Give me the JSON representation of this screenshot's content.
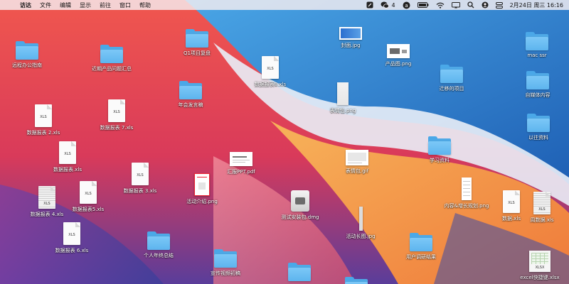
{
  "colors": {
    "folder": "#5db4ee",
    "menubar_bg": "#f5eef0"
  },
  "menubar": {
    "apple": "",
    "menus": [
      "访达",
      "文件",
      "编辑",
      "显示",
      "前往",
      "窗口",
      "帮助"
    ],
    "wechat_count": "4",
    "datetime": "2月24日 周三  16:16",
    "status_icons": [
      "pen-icon",
      "wechat-icon",
      "translate-icon",
      "battery-icon",
      "wifi-icon",
      "screen-mirror-icon",
      "search-icon",
      "user-icon",
      "control-center-icon"
    ]
  },
  "desktop": {
    "items": [
      {
        "name": "远程办公指南",
        "kind": "folder"
      },
      {
        "name": "近期产品问题汇总",
        "kind": "folder"
      },
      {
        "name": "Q1项目复盘",
        "kind": "folder"
      },
      {
        "name": "封面.jpg",
        "kind": "image"
      },
      {
        "name": "产品图.png",
        "kind": "image"
      },
      {
        "name": "mac ssr",
        "kind": "folder"
      },
      {
        "name": "数据报表8.xls",
        "kind": "xls",
        "tag": "XLS"
      },
      {
        "name": "迁移的项目",
        "kind": "folder"
      },
      {
        "name": "自媒体内容",
        "kind": "folder"
      },
      {
        "name": "年会发言稿",
        "kind": "folder"
      },
      {
        "name": "数据报表 2.xls",
        "kind": "xls",
        "tag": "XLS"
      },
      {
        "name": "数据报表 7.xls",
        "kind": "xls",
        "tag": "XLS"
      },
      {
        "name": "表情包.png",
        "kind": "image"
      },
      {
        "name": "以往资料",
        "kind": "folder"
      },
      {
        "name": "学习资料",
        "kind": "folder"
      },
      {
        "name": "数据报表.xls",
        "kind": "xls",
        "tag": "XLS"
      },
      {
        "name": "汇报PPT.pdf",
        "kind": "image"
      },
      {
        "name": "表情包.gif",
        "kind": "image"
      },
      {
        "name": "数据报表 3.xls",
        "kind": "xls",
        "tag": "XLS"
      },
      {
        "name": "活动介绍.png",
        "kind": "image"
      },
      {
        "name": "内容&增长规划.png",
        "kind": "image"
      },
      {
        "name": "数据.xls",
        "kind": "xls",
        "tag": "XLS"
      },
      {
        "name": "周数据.xls",
        "kind": "xls",
        "tag": "XLS"
      },
      {
        "name": "数据报表 4.xls",
        "kind": "xls",
        "tag": "XLS"
      },
      {
        "name": "数据报表5.xls",
        "kind": "xls",
        "tag": "XLS"
      },
      {
        "name": "测试安装包.dmg",
        "kind": "dmg"
      },
      {
        "name": "活动长图.jpg",
        "kind": "image"
      },
      {
        "name": "数据报表 6.xls",
        "kind": "xls",
        "tag": "XLS"
      },
      {
        "name": "个人年终总结",
        "kind": "folder"
      },
      {
        "name": "用户调研结果",
        "kind": "folder"
      },
      {
        "name": "宣传视频初稿",
        "kind": "folder"
      },
      {
        "name": "excel快捷键.xlsx",
        "kind": "xlsx",
        "tag": "XLSX"
      },
      {
        "name": "",
        "kind": "folder"
      },
      {
        "name": "",
        "kind": "folder"
      }
    ]
  }
}
